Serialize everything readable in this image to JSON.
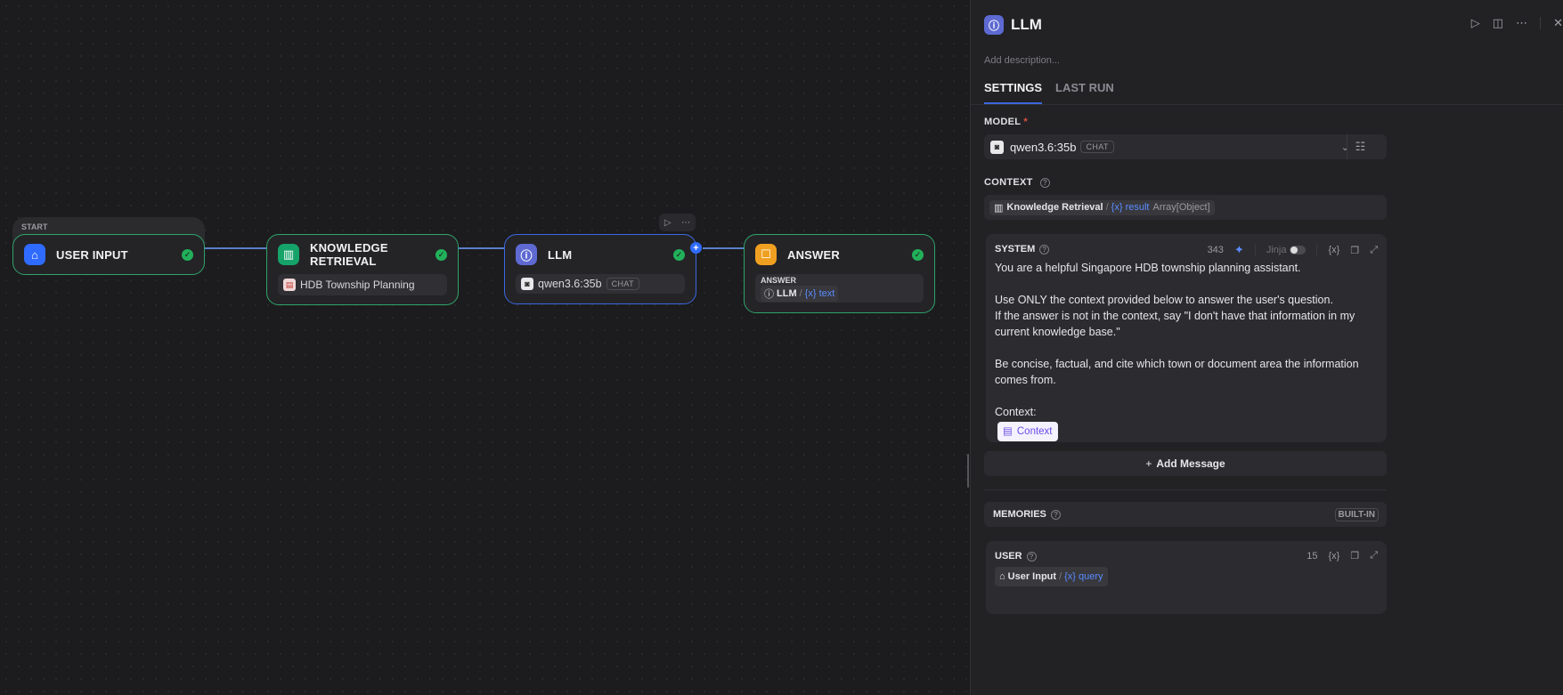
{
  "canvas": {
    "start_label": "START",
    "nodes": {
      "user_input": {
        "title": "USER INPUT"
      },
      "knowledge": {
        "title": "KNOWLEDGE RETRIEVAL",
        "dataset": "HDB Township Planning"
      },
      "llm": {
        "title": "LLM",
        "model": "qwen3.6:35b",
        "model_badge": "CHAT"
      },
      "answer": {
        "title": "ANSWER",
        "sub_label": "ANSWER",
        "var_node": "LLM",
        "var_name": "text"
      }
    },
    "colors": {
      "node_border": "#2fa36a",
      "selected_border": "#3b68e0",
      "check": "#22b05a"
    }
  },
  "panel": {
    "title": "LLM",
    "description_placeholder": "Add description...",
    "tabs": [
      "SETTINGS",
      "LAST RUN"
    ],
    "model": {
      "label": "MODEL",
      "required": "*",
      "name": "qwen3.6:35b",
      "badge": "CHAT"
    },
    "context": {
      "label": "CONTEXT",
      "source_node": "Knowledge Retrieval",
      "var_name": "result",
      "var_type": "Array[Object]"
    },
    "system": {
      "label": "SYSTEM",
      "token_count": "343",
      "jinja_label": "Jinja",
      "lines": [
        "You are a helpful Singapore HDB township planning assistant.",
        "",
        "Use ONLY the context provided below to answer the user's question.",
        "If the answer is not in the context, say \"I don't have that information in my current knowledge base.\"",
        "",
        "Be concise, factual, and cite which town or document area the information comes from.",
        "",
        "Context:"
      ],
      "context_chip": "Context"
    },
    "add_message": "Add Message",
    "memories": {
      "label": "MEMORIES",
      "badge": "BUILT-IN"
    },
    "user": {
      "label": "USER",
      "token_count": "15",
      "source_node": "User Input",
      "var_name": "query"
    }
  }
}
